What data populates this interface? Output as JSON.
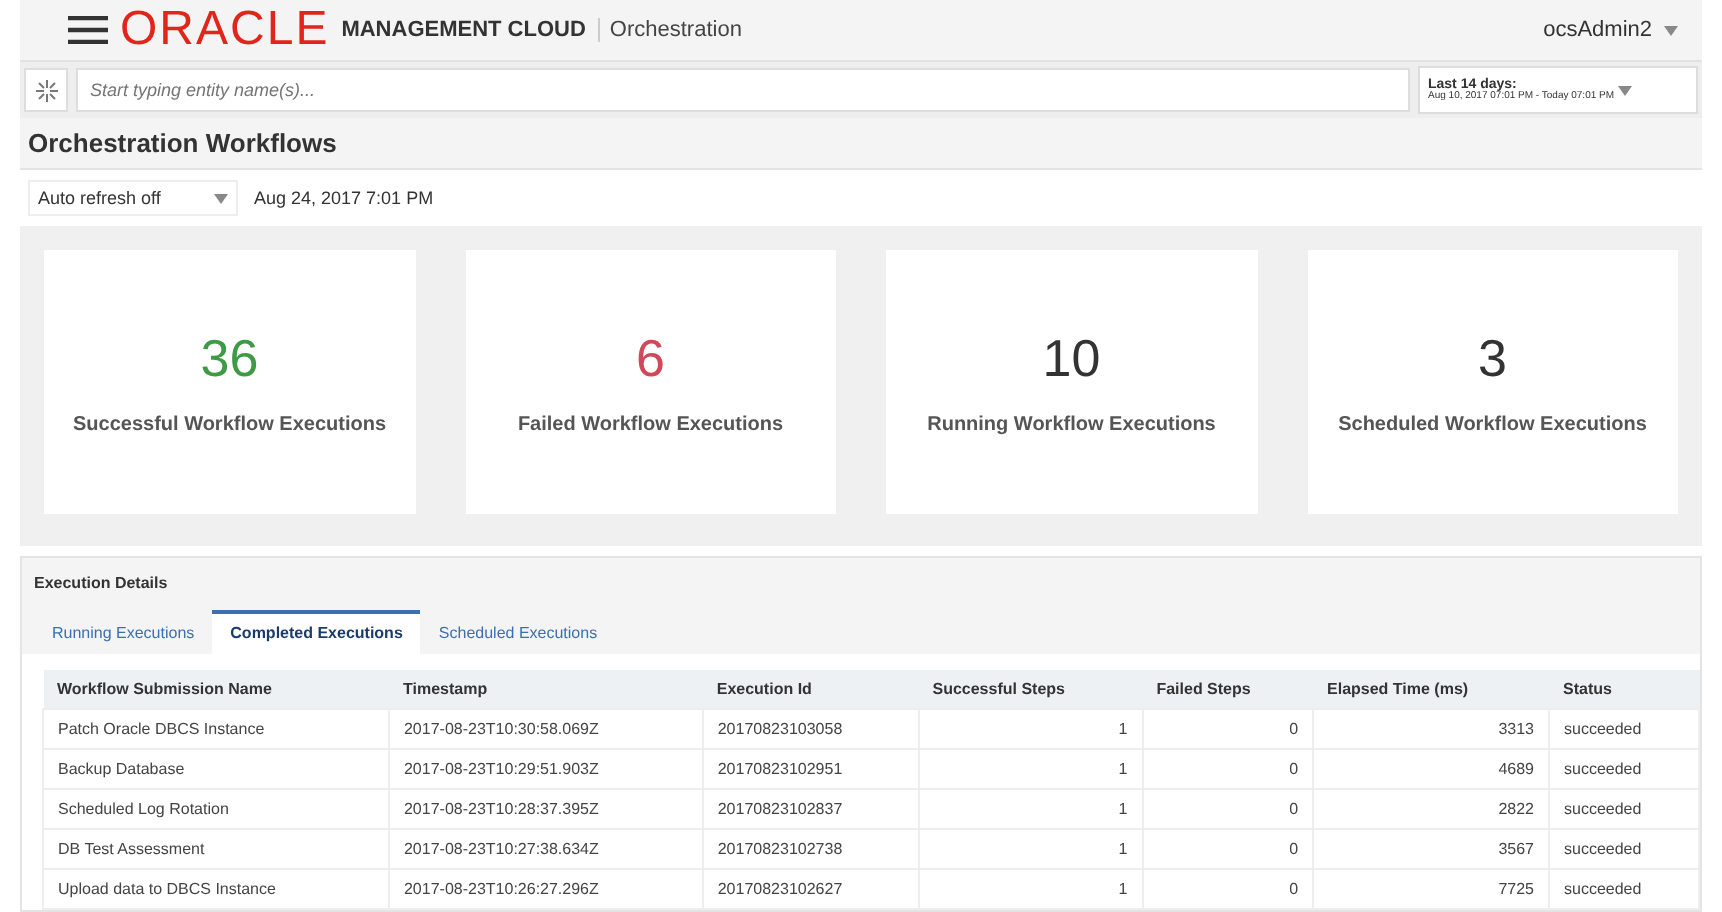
{
  "header": {
    "logo": "ORACLE",
    "product": "MANAGEMENT CLOUD",
    "section": "Orchestration",
    "user": "ocsAdmin2"
  },
  "search": {
    "placeholder": "Start typing entity name(s)...",
    "range_title": "Last 14 days:",
    "range_detail": "Aug 10, 2017 07:01 PM - Today 07:01 PM"
  },
  "page_title": "Orchestration Workflows",
  "refresh": {
    "value": "Auto refresh off",
    "timestamp": "Aug 24, 2017 7:01 PM"
  },
  "summary_cards": [
    {
      "count": "36",
      "label": "Successful Workflow Executions",
      "color": "#3f9a45"
    },
    {
      "count": "6",
      "label": "Failed Workflow Executions",
      "color": "#d0485a"
    },
    {
      "count": "10",
      "label": "Running Workflow Executions",
      "color": "#333333"
    },
    {
      "count": "3",
      "label": "Scheduled Workflow Executions",
      "color": "#333333"
    }
  ],
  "details": {
    "title": "Execution Details",
    "tabs": [
      {
        "label": "Running Executions",
        "selected": false
      },
      {
        "label": "Completed Executions",
        "selected": true
      },
      {
        "label": "Scheduled Executions",
        "selected": false
      }
    ],
    "table": {
      "columns": [
        "Workflow Submission Name",
        "Timestamp",
        "Execution Id",
        "Successful Steps",
        "Failed Steps",
        "Elapsed Time (ms)",
        "Status"
      ],
      "rows": [
        [
          "Patch Oracle DBCS Instance",
          "2017-08-23T10:30:58.069Z",
          "20170823103058",
          "1",
          "0",
          "3313",
          "succeeded"
        ],
        [
          "Backup Database",
          "2017-08-23T10:29:51.903Z",
          "20170823102951",
          "1",
          "0",
          "4689",
          "succeeded"
        ],
        [
          "Scheduled Log Rotation",
          "2017-08-23T10:28:37.395Z",
          "20170823102837",
          "1",
          "0",
          "2822",
          "succeeded"
        ],
        [
          "DB Test Assessment",
          "2017-08-23T10:27:38.634Z",
          "20170823102738",
          "1",
          "0",
          "3567",
          "succeeded"
        ],
        [
          "Upload data to DBCS Instance",
          "2017-08-23T10:26:27.296Z",
          "20170823102627",
          "1",
          "0",
          "7725",
          "succeeded"
        ]
      ]
    }
  }
}
